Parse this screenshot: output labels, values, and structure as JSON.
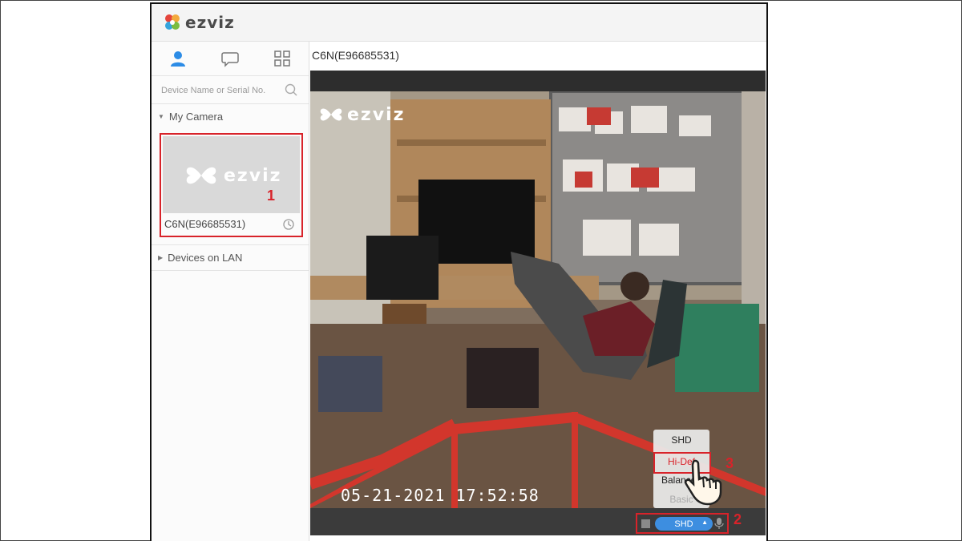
{
  "app": {
    "brand": "ezviz",
    "camera_title": "C6N(E96685531)"
  },
  "sidebar": {
    "tabs": [
      {
        "name": "person-icon",
        "active": true
      },
      {
        "name": "message-icon",
        "active": false
      },
      {
        "name": "grid-icon",
        "active": false
      }
    ],
    "search": {
      "placeholder": "Device Name or Serial No."
    },
    "my_camera_label": "My Camera",
    "camera_card": {
      "brand": "ezviz",
      "name": "C6N(E96685531)"
    },
    "devices_on_lan_label": "Devices on LAN"
  },
  "video": {
    "overlay_brand": "ezviz",
    "timestamp": "05-21-2021 17:52:58",
    "quality_button_label": "SHD",
    "quality_menu": [
      "SHD",
      "Hi-Def",
      "Balanced",
      "Basic"
    ],
    "selected_menu_item": "Hi-Def"
  },
  "steps": {
    "one": "1",
    "two": "2",
    "three": "3"
  },
  "colors": {
    "accent_red": "#d8232a",
    "blue_button": "#3d8ee0"
  }
}
